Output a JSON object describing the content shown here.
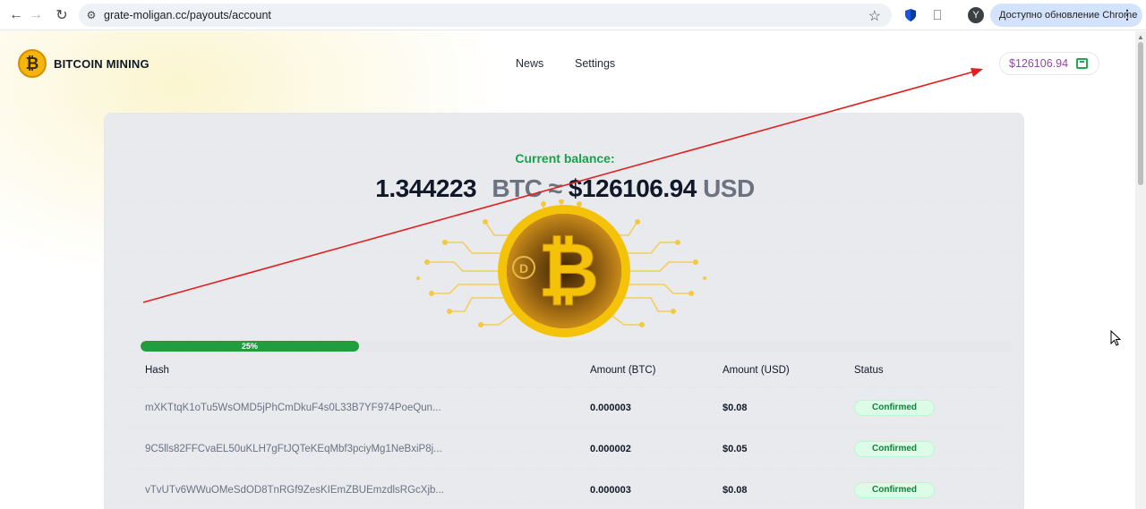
{
  "browser": {
    "url": "grate-moligan.cc/payouts/account",
    "profile_initial": "Y",
    "update_label": "Доступно обновление Chrome"
  },
  "site": {
    "logo_text": "BITCOIN MINING",
    "nav": [
      "News",
      "Settings"
    ],
    "balance_pill": "$126106.94"
  },
  "balance": {
    "label": "Current balance:",
    "btc_amount": "1.344223",
    "btc_unit": "BTC",
    "approx": "≈",
    "usd_amount": "$126106.94",
    "usd_unit": "USD"
  },
  "progress": {
    "label": "25%",
    "value": 0.25
  },
  "table": {
    "headers": [
      "Hash",
      "Amount (BTC)",
      "Amount (USD)",
      "Status"
    ],
    "rows": [
      {
        "hash": "mXKTtqK1oTu5WsOMD5jPhCmDkuF4s0L33B7YF974PoeQun...",
        "btc": "0.000003",
        "usd": "$0.08",
        "status": "Confirmed"
      },
      {
        "hash": "9C5lls82FFCvaEL50uKLH7gFtJQTeKEqMbf3pciyMg1NeBxiP8j...",
        "btc": "0.000002",
        "usd": "$0.05",
        "status": "Confirmed"
      },
      {
        "hash": "vTvUTv6WWuOMeSdOD8TnRGf9ZesKIEmZBUEmzdlsRGcXjb...",
        "btc": "0.000003",
        "usd": "$0.08",
        "status": "Confirmed"
      }
    ]
  },
  "colors": {
    "accent_green": "#16a34a",
    "annotation_red": "#e02020",
    "coin_gold": "#f5b50a"
  }
}
